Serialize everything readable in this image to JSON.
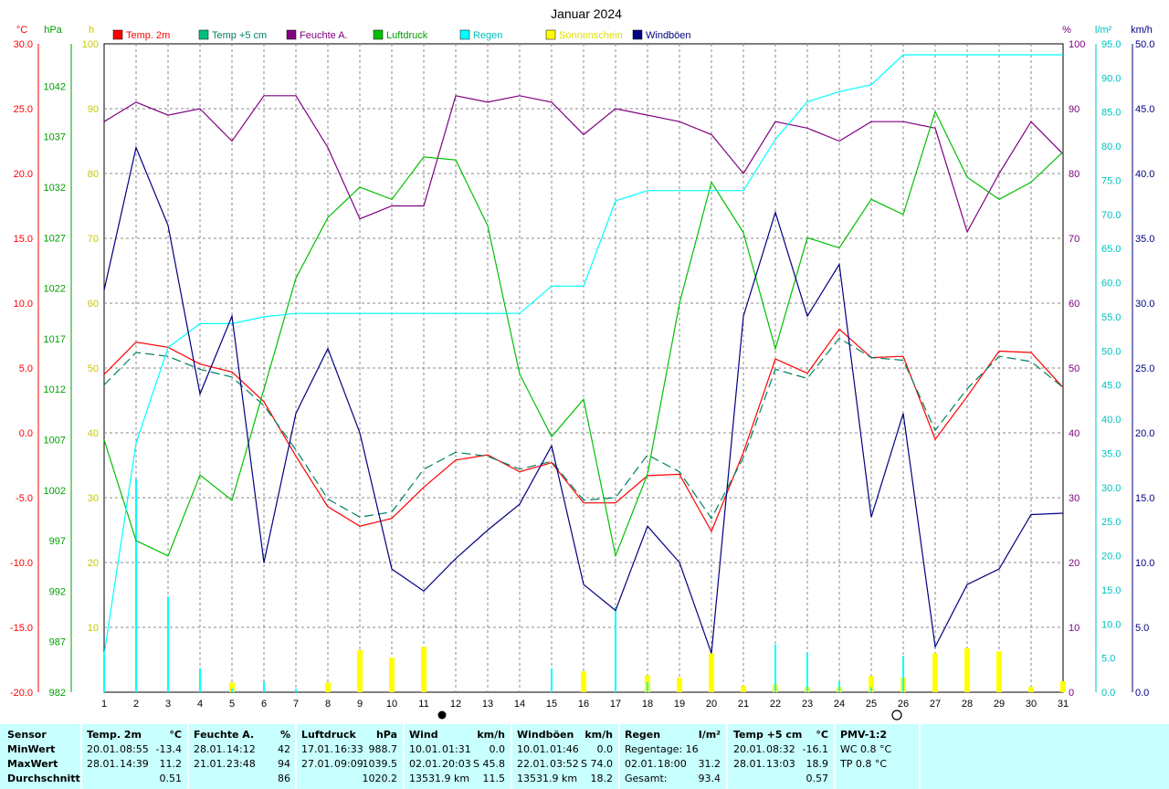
{
  "title": "Januar 2024",
  "axes": {
    "temp": {
      "unit": "°C",
      "ticks": [
        "30.0",
        "25.0",
        "20.0",
        "15.0",
        "10.0",
        "5.0",
        "0.0",
        "-5.0",
        "-10.0",
        "-15.0",
        "-20.0"
      ],
      "color": "#ff0000"
    },
    "pressure": {
      "unit": "hPa",
      "ticks": [
        "1042",
        "1037",
        "1032",
        "1027",
        "1022",
        "1017",
        "1012",
        "1007",
        "1002",
        "997",
        "992",
        "987",
        "982"
      ],
      "color": "#00a000"
    },
    "hours": {
      "unit": "h",
      "ticks": [
        "100",
        "90",
        "80",
        "70",
        "60",
        "50",
        "40",
        "30",
        "20",
        "10"
      ],
      "color": "#c8c800"
    },
    "humidity": {
      "unit": "%",
      "ticks": [
        "100",
        "90",
        "80",
        "70",
        "60",
        "50",
        "40",
        "30",
        "20",
        "10",
        "0"
      ],
      "color": "#800080"
    },
    "rain": {
      "unit": "l/m²",
      "ticks": [
        "95.0",
        "90.0",
        "85.0",
        "80.0",
        "75.0",
        "70.0",
        "65.0",
        "60.0",
        "55.0",
        "50.0",
        "45.0",
        "40.0",
        "35.0",
        "30.0",
        "25.0",
        "20.0",
        "15.0",
        "10.0",
        "5.0",
        "0.0"
      ],
      "color": "#00c0c0"
    },
    "wind": {
      "unit": "km/h",
      "ticks": [
        "50.0",
        "45.0",
        "40.0",
        "35.0",
        "30.0",
        "25.0",
        "20.0",
        "15.0",
        "10.0",
        "5.0",
        "0.0"
      ],
      "color": "#000080"
    },
    "days": [
      "1",
      "2",
      "3",
      "4",
      "5",
      "6",
      "7",
      "8",
      "9",
      "10",
      "11",
      "12",
      "13",
      "14",
      "15",
      "16",
      "17",
      "18",
      "19",
      "20",
      "21",
      "22",
      "23",
      "24",
      "25",
      "26",
      "27",
      "28",
      "29",
      "30",
      "31"
    ]
  },
  "chart_data": {
    "type": "line",
    "title": "Januar 2024",
    "x": [
      1,
      2,
      3,
      4,
      5,
      6,
      7,
      8,
      9,
      10,
      11,
      12,
      13,
      14,
      15,
      16,
      17,
      18,
      19,
      20,
      21,
      22,
      23,
      24,
      25,
      26,
      27,
      28,
      29,
      30,
      31
    ],
    "xlim": [
      1,
      31
    ],
    "series": [
      {
        "name": "Temp. 2m",
        "axis": "temp",
        "unit": "°C",
        "color": "#ff0000",
        "style": "solid",
        "values": [
          4.5,
          7.0,
          6.6,
          5.3,
          4.7,
          2.4,
          -1.8,
          -5.7,
          -7.2,
          -6.6,
          -4.2,
          -2.1,
          -1.7,
          -3.0,
          -2.3,
          -5.4,
          -5.4,
          -3.3,
          -3.2,
          -7.6,
          -1.5,
          5.7,
          4.6,
          8.0,
          5.8,
          5.9,
          -0.5,
          2.8,
          6.3,
          6.2,
          3.5
        ]
      },
      {
        "name": "Temp +5 cm",
        "axis": "temp",
        "unit": "°C",
        "color": "#008060",
        "style": "dashed",
        "values": [
          3.7,
          6.2,
          5.9,
          4.9,
          4.3,
          2.1,
          -1.3,
          -5.1,
          -6.5,
          -6.1,
          -2.8,
          -1.5,
          -1.8,
          -2.8,
          -2.2,
          -5.2,
          -5.0,
          -1.7,
          -3.0,
          -6.6,
          -1.9,
          4.9,
          4.2,
          7.3,
          5.8,
          5.6,
          0.2,
          3.4,
          5.9,
          5.5,
          3.5
        ]
      },
      {
        "name": "Feuchte A.",
        "axis": "humidity",
        "unit": "%",
        "color": "#800080",
        "style": "solid",
        "values": [
          88,
          91,
          89,
          90,
          85,
          92,
          92,
          84,
          73,
          75,
          75,
          92,
          91,
          92,
          91,
          86,
          90,
          89,
          88,
          86,
          80,
          88,
          87,
          85,
          88,
          88,
          87,
          71,
          80,
          88,
          83
        ]
      },
      {
        "name": "Luftdruck",
        "axis": "pressure",
        "unit": "hPa",
        "color": "#00c000",
        "style": "solid",
        "values": [
          1007,
          997,
          995.5,
          1003.5,
          1001,
          1012,
          1023,
          1029,
          1032,
          1030.8,
          1035,
          1034.7,
          1028.2,
          1013.5,
          1007.3,
          1011,
          995.5,
          1003.6,
          1020.5,
          1032.5,
          1027.5,
          1016,
          1027,
          1026,
          1030.8,
          1029.3,
          1039.5,
          1033,
          1030.8,
          1032.5,
          1035.5
        ]
      },
      {
        "name": "Regen",
        "axis": "rain",
        "unit": "l/m²",
        "color": "#00ffff",
        "style": "cumulative",
        "values": [
          5.5,
          36.5,
          50.5,
          54.0,
          54.0,
          55.0,
          55.5,
          55.5,
          55.5,
          55.5,
          55.5,
          55.5,
          55.5,
          55.5,
          59.5,
          59.5,
          72.0,
          73.5,
          73.5,
          73.5,
          73.5,
          81.0,
          86.5,
          88.0,
          89.0,
          93.4,
          93.4,
          93.4,
          93.4,
          93.4,
          93.4
        ]
      },
      {
        "name": "Sonnenschein",
        "axis": "hours",
        "unit": "h",
        "color": "#ffff00",
        "style": "bar",
        "values": [
          0,
          0,
          0,
          0,
          1.5,
          0,
          0,
          1.5,
          6.5,
          5.3,
          7.0,
          0,
          0,
          0,
          0,
          3.2,
          0,
          2.6,
          2.2,
          6.0,
          1.0,
          1.2,
          0.8,
          0.8,
          2.5,
          2.3,
          6.0,
          6.8,
          6.3,
          0.8,
          1.7
        ]
      },
      {
        "name": "Windböen",
        "axis": "wind",
        "unit": "km/h",
        "color": "#000080",
        "style": "solid",
        "values": [
          31.0,
          42.0,
          36.0,
          23.0,
          29.0,
          10.0,
          21.5,
          26.5,
          20.0,
          9.5,
          7.8,
          10.3,
          12.5,
          14.5,
          19.0,
          8.3,
          6.3,
          12.8,
          10.0,
          3.0,
          29.0,
          37.0,
          29.0,
          33.0,
          13.5,
          21.5,
          3.5,
          8.3,
          9.5,
          13.7,
          13.8
        ]
      },
      {
        "name": "Regen (Tagesmenge)",
        "axis": "rain",
        "unit": "l/m²",
        "color": "#00ffff",
        "style": "daily-bar",
        "values": [
          5.5,
          31.2,
          14.0,
          3.5,
          0.5,
          1.5,
          0.5,
          0,
          0,
          0,
          0,
          0,
          0,
          0,
          3.5,
          0,
          12.5,
          1.5,
          0,
          0,
          0,
          7.0,
          5.8,
          1.5,
          0.7,
          5.3,
          0,
          0,
          0,
          0,
          0
        ]
      }
    ],
    "legend": "top",
    "grid": true
  },
  "legend": [
    {
      "label": "Temp. 2m",
      "color": "#ff0000",
      "text_color": "#ff0000"
    },
    {
      "label": "Temp +5 cm",
      "color": "#00c080",
      "text_color": "#008060"
    },
    {
      "label": "Feuchte A.",
      "color": "#800080",
      "text_color": "#800080"
    },
    {
      "label": "Luftdruck",
      "color": "#00c000",
      "text_color": "#00a000"
    },
    {
      "label": "Regen",
      "color": "#00ffff",
      "text_color": "#00c0c0"
    },
    {
      "label": "Sonnenschein",
      "color": "#ffff00",
      "text_color": "#e0e000"
    },
    {
      "label": "Windböen",
      "color": "#000080",
      "text_color": "#000080"
    }
  ],
  "stats": {
    "rowlabels": {
      "title": "Sensor",
      "min": "MinWert",
      "max": "MaxWert",
      "avg": "Durchschnitt"
    },
    "temp2m": {
      "title": "Temp. 2m",
      "unit": "°C",
      "min_date": "20.01.",
      "min_time": "08:55",
      "min": "-13.4",
      "max_date": "28.01.",
      "max_time": "14:39",
      "max": "11.2",
      "avg": "0.51"
    },
    "feuchte": {
      "title": "Feuchte A.",
      "unit": "%",
      "min_date": "28.01.",
      "min_time": "14:12",
      "min": "42",
      "max_date": "21.01.",
      "max_time": "23:48",
      "max": "94",
      "avg": "86"
    },
    "luftdruck": {
      "title": "Luftdruck",
      "unit": "hPa",
      "min_date": "17.01.",
      "min_time": "16:33",
      "min": "988.7",
      "max_date": "27.01.",
      "max_time": "09:09",
      "max": "1039.5",
      "avg": "1020.2"
    },
    "wind": {
      "title": "Wind",
      "unit": "km/h",
      "min_date": "10.01.",
      "min_time": "01:31",
      "min": "0.0",
      "max_date": "02.01.",
      "max_time": "20:03",
      "max": "S 45.8",
      "avg_left": "13531.9 km",
      "avg": "11.5"
    },
    "boeen": {
      "title": "Windböen",
      "unit": "km/h",
      "min_date": "10.01.",
      "min_time": "01:46",
      "min": "0.0",
      "max_date": "22.01.",
      "max_time": "03:52",
      "max": "S 74.0",
      "avg_left": "13531.9 km",
      "avg": "18.2"
    },
    "regen": {
      "title": "Regen",
      "unit": "l/m²",
      "min_text": "Regentage: 16",
      "max_date": "02.01.",
      "max_time": "18:00",
      "max": "31.2",
      "avg_left": "Gesamt:",
      "avg": "93.4"
    },
    "temp5": {
      "title": "Temp +5 cm",
      "unit": "°C",
      "min_date": "20.01.",
      "min_time": "08:32",
      "min": "-16.1",
      "max_date": "28.01.",
      "max_time": "13:03",
      "max": "18.9",
      "avg": "0.57"
    },
    "pmv": {
      "title": "PMV-1:2",
      "min": "WC 0.8 °C",
      "max": "TP 0.8 °C"
    }
  }
}
